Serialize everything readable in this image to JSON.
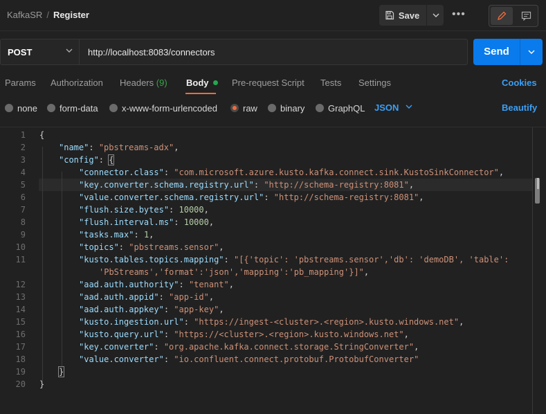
{
  "header": {
    "collection": "KafkaSR",
    "separator": "/",
    "request_name": "Register",
    "save_label": "Save",
    "more_label": "•••"
  },
  "request": {
    "method": "POST",
    "url": "http://localhost:8083/connectors",
    "send_label": "Send"
  },
  "tabs": {
    "params": "Params",
    "authorization": "Authorization",
    "headers": "Headers",
    "headers_count": "(9)",
    "body": "Body",
    "prerequest": "Pre-request Script",
    "tests": "Tests",
    "settings": "Settings",
    "cookies": "Cookies"
  },
  "body_types": {
    "none": "none",
    "form_data": "form-data",
    "urlencoded": "x-www-form-urlencoded",
    "raw": "raw",
    "binary": "binary",
    "graphql": "GraphQL",
    "selected": "raw",
    "format": "JSON",
    "beautify": "Beautify"
  },
  "colors": {
    "accent": "#f26b3a",
    "send": "#097bed",
    "link": "#3b9ff5",
    "json_key": "#9cdcfe",
    "json_string": "#ce9178",
    "json_number": "#b5cea8"
  },
  "editor": {
    "line_numbers": [
      "1",
      "2",
      "3",
      "4",
      "5",
      "6",
      "7",
      "8",
      "9",
      "10",
      "11",
      "",
      "12",
      "13",
      "14",
      "15",
      "16",
      "17",
      "18",
      "19",
      "20"
    ],
    "current_line": "5",
    "code": {
      "l1_open": "{",
      "l2_key": "\"name\"",
      "l2_val": "\"pbstreams-adx\"",
      "l3_key": "\"config\"",
      "l3_open": "{",
      "l4_key": "\"connector.class\"",
      "l4_val": "\"com.microsoft.azure.kusto.kafka.connect.sink.KustoSinkConnector\"",
      "l5_key": "\"key.converter.schema.registry.url\"",
      "l5_val": "\"http://schema-registry:8081\"",
      "l6_key": "\"value.converter.schema.registry.url\"",
      "l6_val": "\"http://schema-registry:8081\"",
      "l7_key": "\"flush.size.bytes\"",
      "l7_val": "10000",
      "l8_key": "\"flush.interval.ms\"",
      "l8_val": "10000",
      "l9_key": "\"tasks.max\"",
      "l9_val": "1",
      "l10_key": "\"topics\"",
      "l10_val": "\"pbstreams.sensor\"",
      "l11_key": "\"kusto.tables.topics.mapping\"",
      "l11_val_a": "\"[{'topic': 'pbstreams.sensor','db': 'demoDB', 'table':",
      "l11_val_b": "'PbStreams','format':'json','mapping':'pb_mapping'}]\"",
      "l12_key": "\"aad.auth.authority\"",
      "l12_val": "\"tenant\"",
      "l13_key": "\"aad.auth.appid\"",
      "l13_val": "\"app-id\"",
      "l14_key": "\"aad.auth.appkey\"",
      "l14_val": "\"app-key\"",
      "l15_key": "\"kusto.ingestion.url\"",
      "l15_val": "\"https://ingest-<cluster>.<region>.kusto.windows.net\"",
      "l16_key": "\"kusto.query.url\"",
      "l16_val": "\"https://<cluster>.<region>.kusto.windows.net\"",
      "l17_key": "\"key.converter\"",
      "l17_val": "\"org.apache.kafka.connect.storage.StringConverter\"",
      "l18_key": "\"value.converter\"",
      "l18_val": "\"io.confluent.connect.protobuf.ProtobufConverter\"",
      "l19_close": "}",
      "l20_close": "}"
    }
  }
}
